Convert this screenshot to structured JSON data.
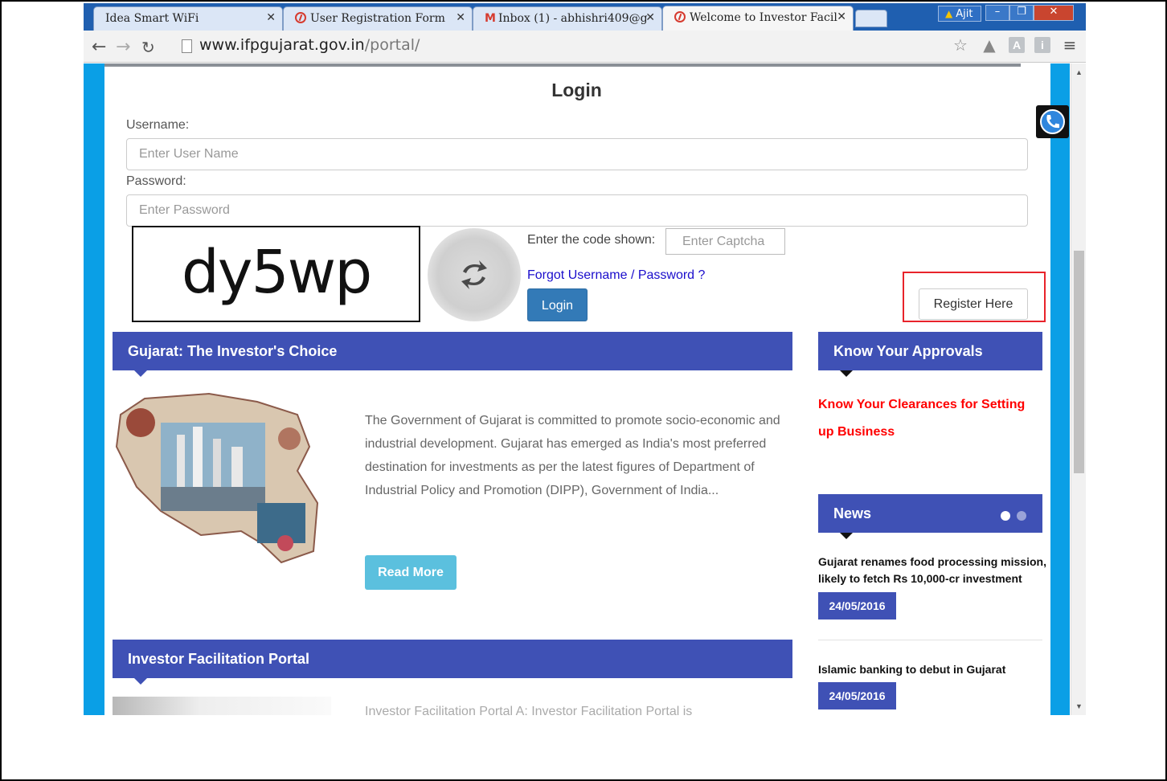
{
  "browser": {
    "tabs": [
      {
        "label": "Idea Smart WiFi",
        "icon": "none"
      },
      {
        "label": "User Registration Form",
        "icon": "site-icon"
      },
      {
        "label": "Inbox (1) - abhishri409@g",
        "icon": "gmail-icon"
      },
      {
        "label": "Welcome to Investor Facil",
        "icon": "site-icon",
        "active": true
      }
    ],
    "profile_name": "Ajit",
    "url_host": "www.ifpgujarat.gov.in",
    "url_path": "/portal/",
    "toolbar_icons": [
      "star-icon",
      "drive-icon",
      "extension-a-icon",
      "extension-i-icon",
      "menu-icon"
    ],
    "toolbar_letters": {
      "a": "A",
      "i": "i"
    }
  },
  "login": {
    "title": "Login",
    "username_label": "Username:",
    "username_placeholder": "Enter User Name",
    "password_label": "Password:",
    "password_placeholder": "Enter Password",
    "captcha_text": "dy5wp",
    "captcha_label": "Enter the code shown:",
    "captcha_placeholder": "Enter Captcha",
    "forgot_link": "Forgot Username / Password ?",
    "login_button": "Login",
    "register_button": "Register Here"
  },
  "investors_choice": {
    "header": "Gujarat: The Investor's Choice",
    "body": "The Government of Gujarat is committed to promote socio-economic and industrial development. Gujarat has emerged as India's most preferred destination for investments as per the latest figures of Department of Industrial Policy and Promotion (DIPP), Government of India...",
    "read_more": "Read More"
  },
  "approvals": {
    "header": "Know Your Approvals",
    "link": "Know Your Clearances for Setting up Business"
  },
  "news": {
    "header": "News",
    "items": [
      {
        "title": "Gujarat renames food processing mission, likely to fetch Rs 10,000-cr investment",
        "date": "24/05/2016"
      },
      {
        "title": "Islamic banking to debut in Gujarat",
        "date": "24/05/2016"
      }
    ]
  },
  "portal": {
    "header": "Investor Facilitation Portal",
    "body_partial": "Investor Facilitation Portal A: Investor Facilitation Portal is"
  },
  "colors": {
    "accent_blue": "#0a9fe6",
    "section_header": "#3f51b5",
    "login_button": "#337ab7",
    "read_more": "#5bc0de",
    "highlight": "#e8232b",
    "approval_link": "#ff0000"
  }
}
